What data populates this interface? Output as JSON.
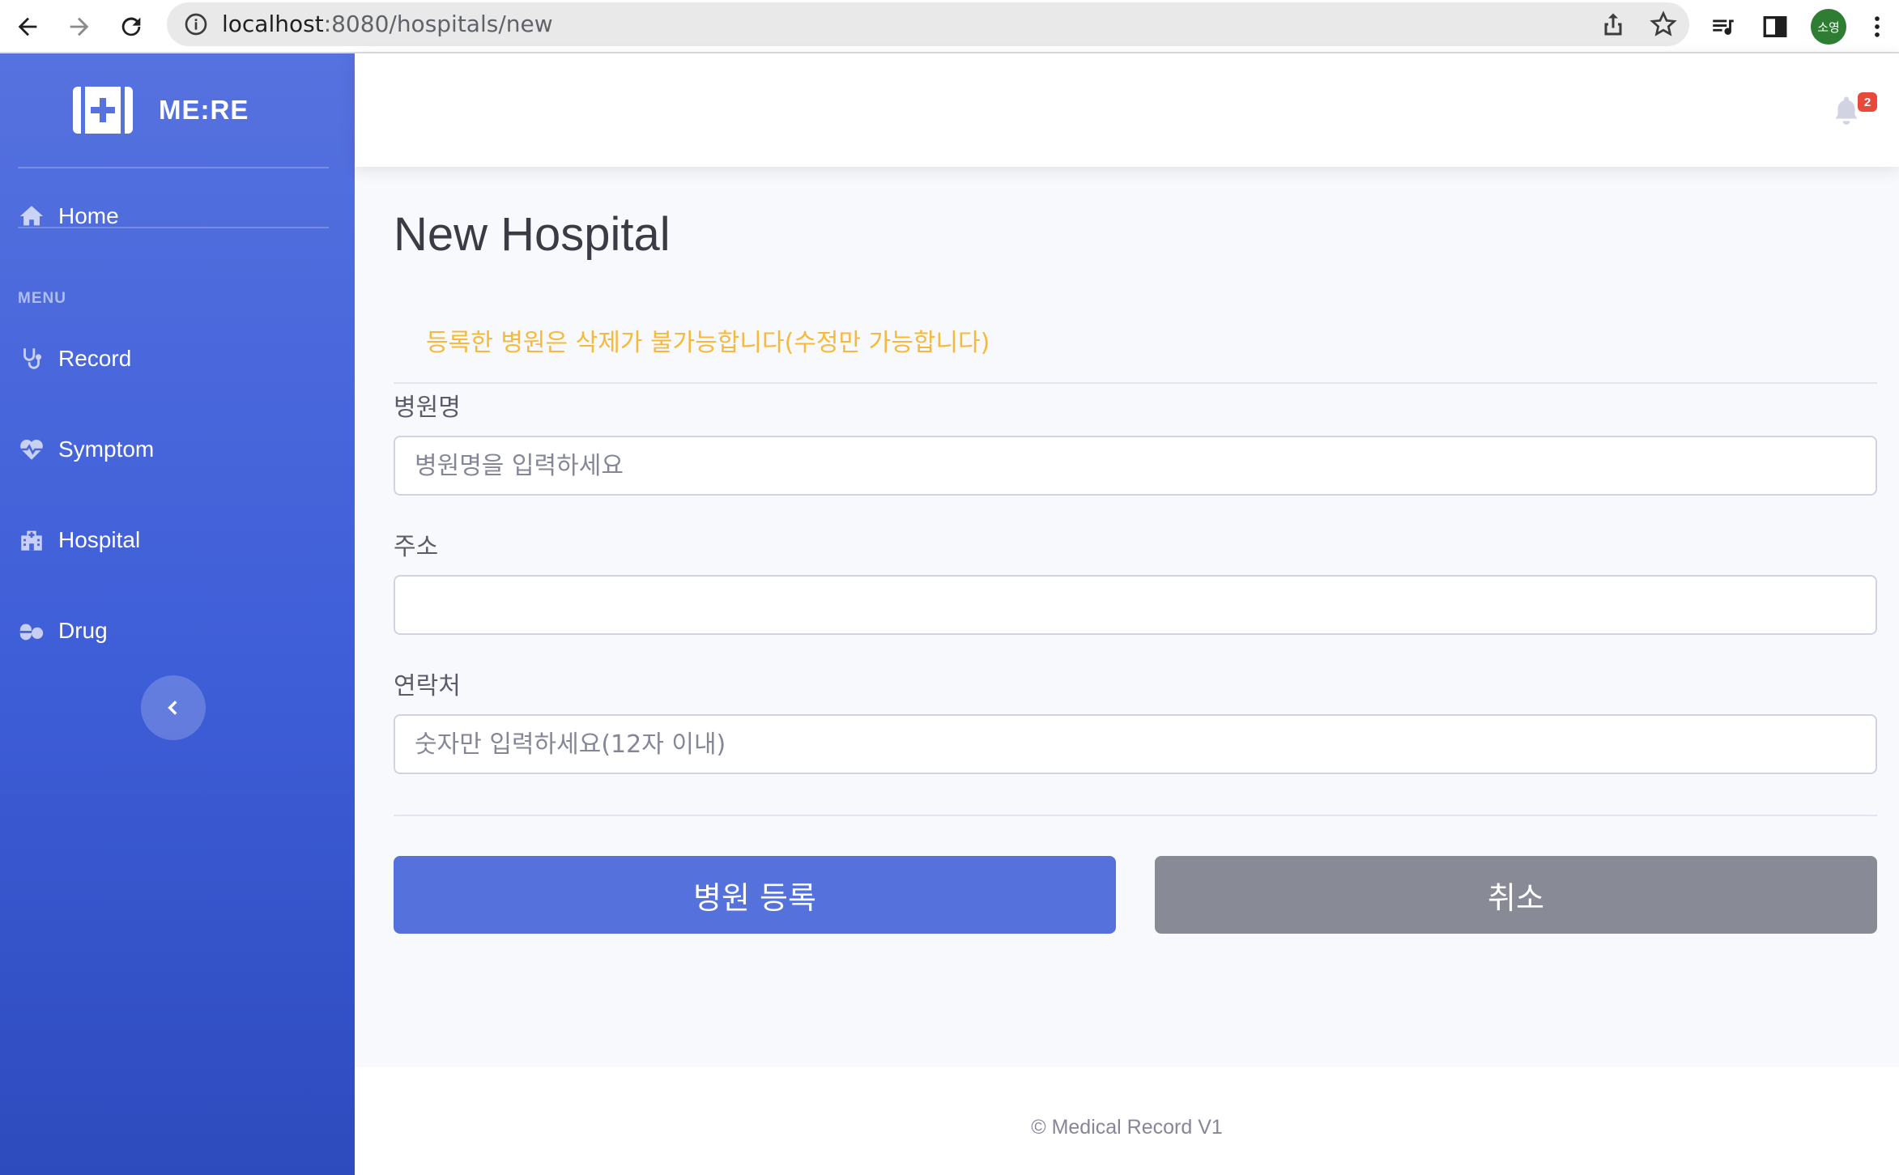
{
  "browser": {
    "url_host": "localhost",
    "url_rest": ":8080/hospitals/new",
    "profile_initials": "소영"
  },
  "sidebar": {
    "brand": "ME:RE",
    "home_label": "Home",
    "menu_heading": "MENU",
    "items": [
      {
        "label": "Record",
        "icon": "stethoscope-icon"
      },
      {
        "label": "Symptom",
        "icon": "heartbeat-icon"
      },
      {
        "label": "Hospital",
        "icon": "hospital-icon"
      },
      {
        "label": "Drug",
        "icon": "pills-icon"
      }
    ]
  },
  "topbar": {
    "notification_count": "2"
  },
  "main": {
    "title": "New Hospital",
    "notice": "등록한 병원은 삭제가 불가능합니다(수정만 가능합니다)",
    "fields": {
      "name_label": "병원명",
      "name_placeholder": "병원명을 입력하세요",
      "address_label": "주소",
      "address_placeholder": "",
      "contact_label": "연락처",
      "contact_placeholder": "숫자만 입력하세요(12자 이내)"
    },
    "submit_label": "병원 등록",
    "cancel_label": "취소"
  },
  "footer": {
    "text": "© Medical Record V1"
  },
  "colors": {
    "primary": "#5471dc",
    "secondary": "#888a95",
    "warning": "#f6b93b",
    "badge": "#e74a3b"
  }
}
